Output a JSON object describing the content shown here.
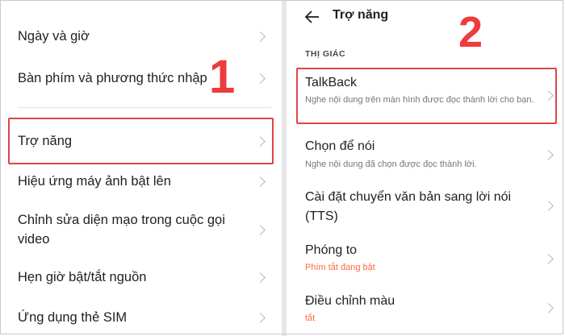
{
  "left_panel": {
    "items": [
      {
        "label": "Ngày và giờ"
      },
      {
        "label": "Bàn phím và phương thức nhập"
      },
      {
        "label": "Trợ năng"
      },
      {
        "label": "Hiệu ứng máy ảnh bật lên"
      },
      {
        "label": "Chỉnh sửa diện mạo trong cuộc gọi video"
      },
      {
        "label": "Hẹn giờ bật/tắt nguồn"
      },
      {
        "label": "Ứng dụng thẻ SIM"
      }
    ],
    "step_number": "1"
  },
  "right_panel": {
    "title": "Trợ năng",
    "section": "THỊ GIÁC",
    "step_number": "2",
    "items": [
      {
        "label": "TalkBack",
        "subtitle": "Nghe nội dung trên màn hình được đọc thành lời cho bạn."
      },
      {
        "label": "Chọn để nói",
        "subtitle": "Nghe nội dung đã chọn được đọc thành lời."
      },
      {
        "label": "Cài đặt chuyển văn bản sang lời nói (TTS)",
        "subtitle": ""
      },
      {
        "label": "Phóng to",
        "subtitle": "Phím tắt đang bật"
      },
      {
        "label": "Điều chỉnh màu",
        "subtitle": "tắt"
      }
    ]
  },
  "colors": {
    "highlight": "#e04545",
    "step_number": "#ee3b3b",
    "accent_subtitle": "#ff6a3d"
  }
}
